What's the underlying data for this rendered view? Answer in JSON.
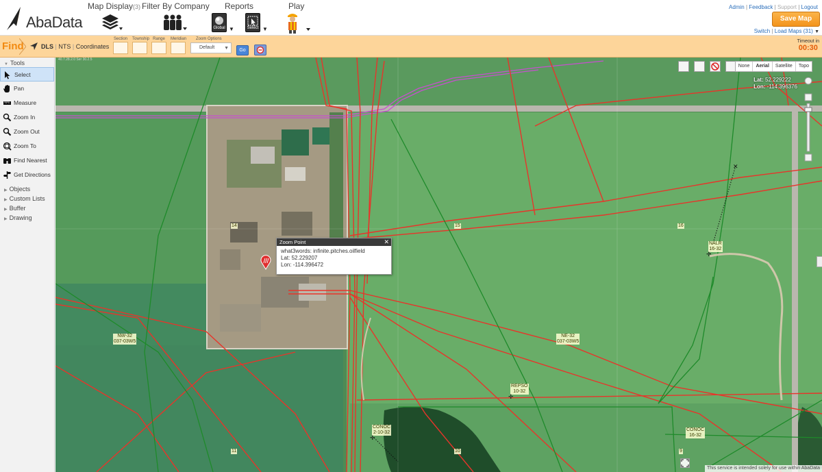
{
  "header": {
    "logo_text": "AbaData",
    "map_display": {
      "title": "Map Display",
      "count": "(3)"
    },
    "filter_company": {
      "title": "Filter By Company"
    },
    "reports": {
      "title": "Reports",
      "global_label": "Global",
      "select_label": "Select"
    },
    "play": {
      "title": "Play"
    },
    "links_top": {
      "admin": "Admin",
      "feedback": "Feedback",
      "support": "Support",
      "logout": "Logout"
    },
    "save_map": "Save Map",
    "links_bottom": {
      "switch": "Switch",
      "load_maps": "Load Maps (31)"
    }
  },
  "findbar": {
    "label": "Find",
    "nav": {
      "dls": "DLS",
      "nts": "NTS",
      "coordinates": "Coordinates"
    },
    "fields": [
      "Section",
      "Township",
      "Range",
      "Meridian"
    ],
    "zoom_options_label": "Zoom Options",
    "zoom_options_value": "Default",
    "go": "Go",
    "timeout_label": "Timeout in",
    "timeout_value": "00:30"
  },
  "sidebar": {
    "tools_title": "Tools",
    "tools": [
      {
        "label": "Select",
        "icon": "cursor-icon",
        "active": true
      },
      {
        "label": "Pan",
        "icon": "hand-icon",
        "active": false
      },
      {
        "label": "Measure",
        "icon": "ruler-icon",
        "active": false
      },
      {
        "label": "Zoom In",
        "icon": "zoom-in-icon",
        "active": false
      },
      {
        "label": "Zoom Out",
        "icon": "zoom-out-icon",
        "active": false
      },
      {
        "label": "Zoom To",
        "icon": "zoom-to-icon",
        "active": false
      },
      {
        "label": "Find Nearest",
        "icon": "binoculars-icon",
        "active": false
      },
      {
        "label": "Get Directions",
        "icon": "directions-icon",
        "active": false
      }
    ],
    "sections": [
      "Objects",
      "Custom Lists",
      "Buffer",
      "Drawing"
    ]
  },
  "map": {
    "tiny_text": "40.7.28.2.0 Ser 30.2.5",
    "modes": [
      "None",
      "Aerial",
      "Satellite",
      "Topo"
    ],
    "selected_mode": "Aerial",
    "lat_label": "Lat:",
    "lat_value": "52.229222",
    "lon_label": "Lon:",
    "lon_value": "-114.396376",
    "popup": {
      "title": "Zoom Point",
      "what3words": "what3words: infinite.pitches.oilfield",
      "lat": "Lat: 52.229207",
      "lon": "Lon: -114.396472"
    },
    "section_labels": [
      {
        "line1": "NW-32",
        "line2": "037-03W5"
      },
      {
        "line1": "NE-32",
        "line2": "037-03W5"
      }
    ],
    "section_numbers": [
      "14",
      "15",
      "16",
      "11",
      "10",
      "9"
    ],
    "well_labels": [
      {
        "line1": "NALR",
        "line2": "16-32"
      },
      {
        "line1": "REPSO",
        "line2": "10-32"
      },
      {
        "line1": "CONOC",
        "line2": "2-10-32"
      },
      {
        "line1": "CONOC",
        "line2": "16-32"
      }
    ],
    "footer": "This service is intended solely for use within AbaData",
    "colors": {
      "pipeline_red": "#e8342a",
      "pipeline_green": "#1e8a2a",
      "pipeline_magenta": "#c84fd0",
      "field": "#5fa865"
    }
  }
}
